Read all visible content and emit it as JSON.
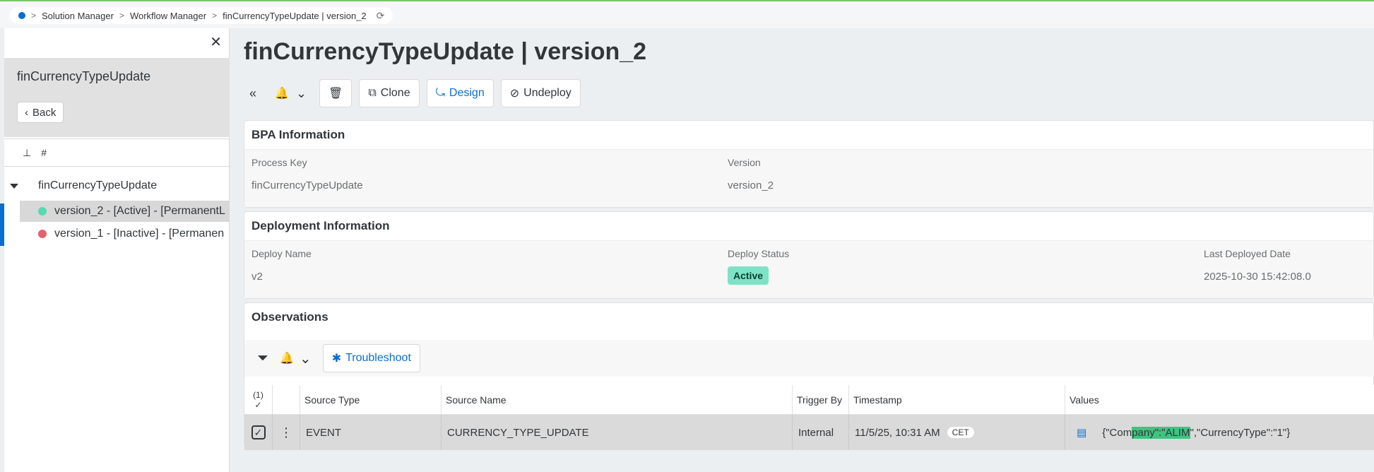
{
  "breadcrumb": {
    "items": [
      "Solution Manager",
      "Workflow Manager",
      "finCurrencyTypeUpdate | version_2"
    ],
    "sep": ">",
    "refresh": "⟳"
  },
  "left_panel": {
    "close": "✕",
    "title": "finCurrencyTypeUpdate",
    "back_label": "Back",
    "pin_icon": "⊥",
    "grid_icon": "#",
    "tree": {
      "root": "finCurrencyTypeUpdate",
      "items": [
        {
          "label": "version_2 - [Active] - [PermanentL",
          "status_color": "#59d9b0"
        },
        {
          "label": "version_1 - [Inactive] - [Permanen",
          "status_color": "#e5606e"
        }
      ]
    }
  },
  "main": {
    "title": "finCurrencyTypeUpdate | version_2",
    "toolbar": {
      "collapse": "«",
      "bell": "🔔",
      "chev": "⌄",
      "delete": "🗑",
      "clone_label": "Clone",
      "design_label": "Design",
      "undeploy_label": "Undeploy"
    },
    "bpa": {
      "title": "BPA Information",
      "process_key_label": "Process Key",
      "process_key_value": "finCurrencyTypeUpdate",
      "version_label": "Version",
      "version_value": "version_2"
    },
    "deployment": {
      "title": "Deployment Information",
      "deploy_name_label": "Deploy Name",
      "deploy_name_value": "v2",
      "deploy_status_label": "Deploy Status",
      "deploy_status_value": "Active",
      "last_deployed_label": "Last Deployed Date",
      "last_deployed_value": "2025-10-30 15:42:08.0"
    },
    "observations": {
      "title": "Observations",
      "filter": "⏷",
      "troubleshoot_label": "Troubleshoot",
      "table": {
        "select_count": "(1)",
        "select_check": "✓",
        "columns": [
          "Source Type",
          "Source Name",
          "Trigger By",
          "Timestamp",
          "Values"
        ],
        "row": {
          "check": "✓",
          "menu": "⋮",
          "source_type": "EVENT",
          "source_name": "CURRENCY_TYPE_UPDATE",
          "trigger_by": "Internal",
          "timestamp": "11/5/25, 10:31 AM",
          "tz": "CET",
          "values_pre": "{\"Com",
          "values_hl": "pany\":\"ALIM",
          "values_post": "\",\"CurrencyType\":\"1\"}"
        }
      }
    }
  },
  "colors": {
    "accent": "#0a6ed1",
    "active_badge": "#7de3c6",
    "highlight": "#40c380"
  }
}
